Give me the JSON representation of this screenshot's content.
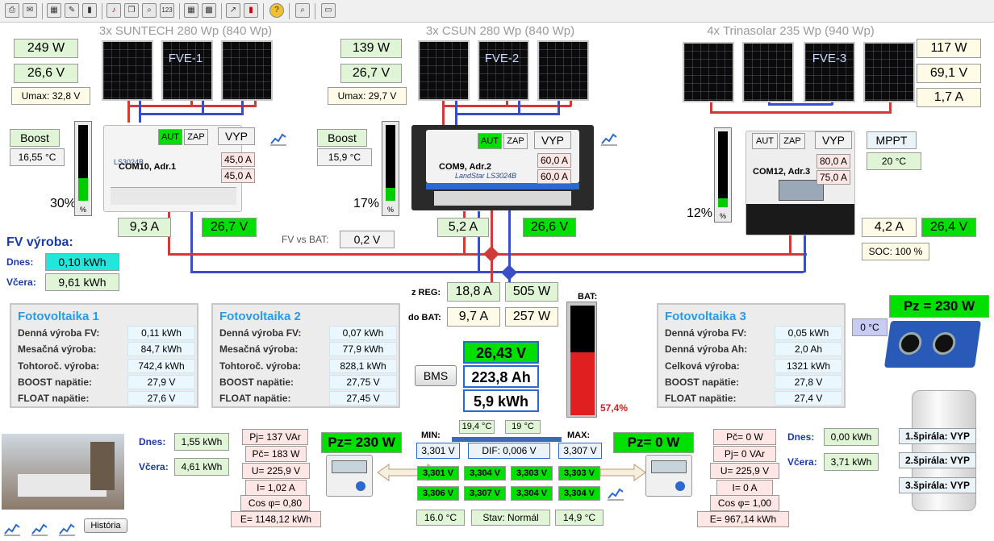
{
  "toolbar": {
    "icons": [
      "print-icon",
      "message-icon",
      "chart-table-icon",
      "chart-edit-icon",
      "bar-chart-icon",
      "bell-icon",
      "copy-icon",
      "zoom-icon",
      "calc-icon",
      "grid-icon",
      "grid2-icon",
      "graph-icon",
      "bar2-icon",
      "help-icon",
      "search-icon",
      "window-icon"
    ]
  },
  "fve1": {
    "title": "3x SUNTECH 280 Wp (840 Wp)",
    "label": "FVE-1",
    "power": "249 W",
    "voltage": "26,6 V",
    "umax": "Umax: 32,8 V",
    "mode_label": "Boost",
    "temp": "16,55 °C",
    "gauge_pct": "30%",
    "gauge_level": 0.3,
    "aut": "AUT",
    "zap": "ZAP",
    "vyp": "VYP",
    "reg_model": "LS3024B",
    "com": "COM10, Adr.1",
    "max1": "45,0 A",
    "max2": "45,0 A",
    "current_out": "9,3 A",
    "voltage_out": "26,7 V"
  },
  "fve2": {
    "title": "3x CSUN 280 Wp (840 Wp)",
    "label": "FVE-2",
    "power": "139 W",
    "voltage": "26,7 V",
    "umax": "Umax: 29,7 V",
    "mode_label": "Boost",
    "temp": "15,9 °C",
    "gauge_pct": "17%",
    "gauge_level": 0.17,
    "aut": "AUT",
    "zap": "ZAP",
    "vyp": "VYP",
    "reg_model": "LandStar LS3024B",
    "com": "COM9, Adr.2",
    "max1": "60,0 A",
    "max2": "60,0 A",
    "current_out": "5,2 A",
    "voltage_out": "26,6 V"
  },
  "fve3": {
    "title": "4x Trinasolar 235 Wp (940 Wp)",
    "label": "FVE-3",
    "power": "117 W",
    "voltage": "69,1 V",
    "current": "1,7 A",
    "mode_label": "MPPT",
    "temp": "20 °C",
    "gauge_pct": "12%",
    "gauge_level": 0.12,
    "aut": "AUT",
    "zap": "ZAP",
    "vyp": "VYP",
    "com": "COM12, Adr.3",
    "max1": "80,0 A",
    "max2": "75,0 A",
    "current_out": "4,2 A",
    "voltage_out": "26,4 V",
    "soc": "SOC:  100 %"
  },
  "fv_vyroba": {
    "title": "FV výroba:",
    "dnes_label": "Dnes:",
    "dnes": "0,10 kWh",
    "vcera_label": "Včera:",
    "vcera": "9,61 kWh",
    "fv_vs_bat_label": "FV vs BAT:",
    "fv_vs_bat": "0,2 V"
  },
  "center": {
    "z_reg_label": "z REG:",
    "z_reg_a": "18,8 A",
    "z_reg_w": "505 W",
    "do_bat_label": "do BAT:",
    "do_bat_a": "9,7 A",
    "do_bat_w": "257 W",
    "bat_voltage": "26,43 V",
    "bat_ah": "223,8 Ah",
    "bat_kwh": "5,9 kWh",
    "bms": "BMS",
    "bat_label": "BAT:",
    "bat_pct": "57,4%",
    "bat_level": 0.574
  },
  "info1": {
    "title": "Fotovoltaika 1",
    "rows": [
      {
        "label": "Denná výroba FV:",
        "value": "0,11 kWh"
      },
      {
        "label": "Mesačná výroba:",
        "value": "84,7 kWh"
      },
      {
        "label": "Tohtoroč. výroba:",
        "value": "742,4 kWh"
      },
      {
        "label": "BOOST napätie:",
        "value": "27,9 V"
      },
      {
        "label": "FLOAT napätie:",
        "value": "27,6 V"
      }
    ]
  },
  "info2": {
    "title": "Fotovoltaika 2",
    "rows": [
      {
        "label": "Denná výroba FV:",
        "value": "0,07 kWh"
      },
      {
        "label": "Mesačná výroba:",
        "value": "77,9 kWh"
      },
      {
        "label": "Tohtoroč. výroba:",
        "value": "828,1 kWh"
      },
      {
        "label": "BOOST napätie:",
        "value": "27,75 V"
      },
      {
        "label": "FLOAT napätie:",
        "value": "27,45 V"
      }
    ]
  },
  "info3": {
    "title": "Fotovoltaika 3",
    "rows": [
      {
        "label": "Denná výroba FV:",
        "value": "0,05 kWh"
      },
      {
        "label": "Denná výroba Ah:",
        "value": "2,0 Ah"
      },
      {
        "label": "Celková výroba:",
        "value": "1321 kWh"
      },
      {
        "label": "BOOST napätie:",
        "value": "27,8 V"
      },
      {
        "label": "FLOAT napätie:",
        "value": "27,4 V"
      }
    ]
  },
  "inverter": {
    "pz": "Pz = 230 W",
    "temp": "0 °C"
  },
  "left_meter": {
    "dnes_label": "Dnes:",
    "dnes": "1,55 kWh",
    "vcera_label": "Včera:",
    "vcera": "4,61 kWh",
    "pj": "Pj= 137 VAr",
    "pc": "Pč= 183 W",
    "u": "U= 225,9 V",
    "i": "I= 1,02 A",
    "cos": "Cos φ= 0,80",
    "e": "E= 1148,12 kWh",
    "pz": "Pz= 230 W",
    "history": "História"
  },
  "right_meter": {
    "pc": "Pč= 0 W",
    "pj": "Pj= 0 VAr",
    "u": "U= 225,9 V",
    "i": "I= 0 A",
    "cos": "Cos φ= 1,00",
    "e": "E= 967,14 kWh",
    "pz": "Pz= 0 W",
    "dnes_label": "Dnes:",
    "dnes": "0,00 kWh",
    "vcera_label": "Včera:",
    "vcera": "3,71 kWh",
    "spirala1": "1.špirála: VYP",
    "spirala2": "2.špirála: VYP",
    "spirala3": "3.špirála: VYP"
  },
  "bms_cells": {
    "min_label": "MIN:",
    "max_label": "MAX:",
    "temp1": "19,4 °C",
    "temp2": "19 °C",
    "min": "3,301 V",
    "dif": "DIF:  0,006 V",
    "max": "3,307 V",
    "row1": [
      "3,301 V",
      "3,304 V",
      "3,303 V",
      "3,303 V"
    ],
    "row2": [
      "3,306 V",
      "3,307 V",
      "3,304 V",
      "3,304 V"
    ],
    "temp_left": "16.0 °C",
    "stav": "Stav: Normál",
    "temp_right": "14,9 °C"
  },
  "colors": {
    "wire_plus": "#d23a3a",
    "wire_minus": "#3a4ec8",
    "active_green": "#00e000",
    "light_green": "#dff5d6",
    "cyan": "#22e6dc",
    "battery_red": "#e02020"
  }
}
